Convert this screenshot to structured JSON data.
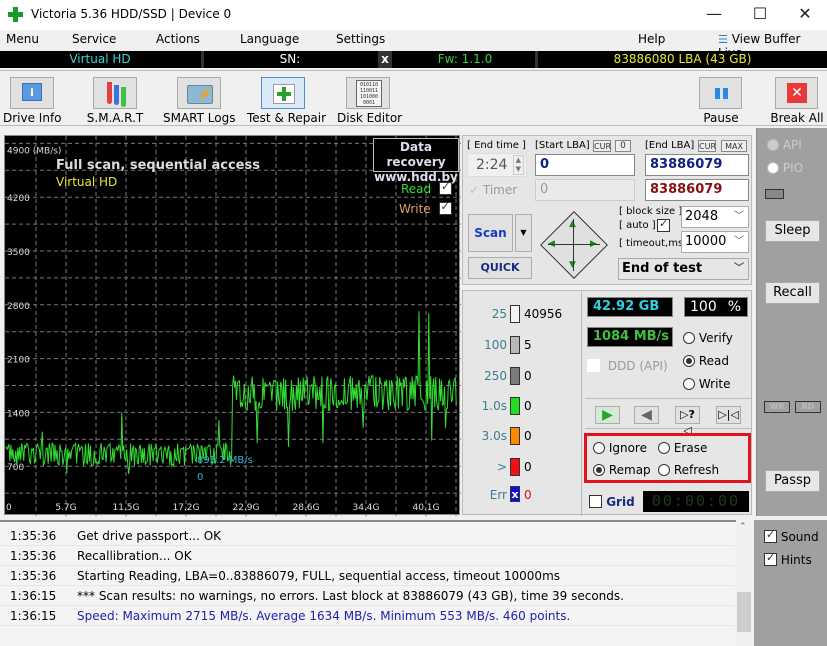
{
  "window": {
    "title": "Victoria 5.36 HDD/SSD | Device 0",
    "controls": {
      "minimize": "—",
      "maximize": "☐",
      "close": "✕"
    }
  },
  "menu": {
    "items": [
      "Menu",
      "Service",
      "Actions",
      "Language",
      "Settings"
    ],
    "help": "Help",
    "view_buffer": "View Buffer Live"
  },
  "drive_strip": {
    "model": "Virtual HD",
    "sn_label": "SN:",
    "close_glyph": "x",
    "firmware": "Fw: 1.1.0",
    "capacity": "83886080 LBA (43 GB)"
  },
  "toolbar": {
    "buttons": [
      {
        "label": "Drive Info",
        "icon": "info-icon"
      },
      {
        "label": "S.M.A.R.T",
        "icon": "test-tubes-icon"
      },
      {
        "label": "SMART Logs",
        "icon": "folder-pen-icon"
      },
      {
        "label": "Test & Repair",
        "icon": "first-aid-kit-icon",
        "active": true
      },
      {
        "label": "Disk Editor",
        "icon": "binary-document-icon"
      }
    ],
    "pause_label": "Pause",
    "break_label": "Break All",
    "binary_text": "010110\n110011\n101000\n0001"
  },
  "chart_data": {
    "type": "line",
    "title": "Full scan, sequential access",
    "subtitle": "Virtual HD",
    "ylabel": "(MB/s)",
    "y_ticks": [
      "4900 (MB/s)",
      "4200",
      "3500",
      "2800",
      "2100",
      "1400",
      "700"
    ],
    "x_ticks": [
      "0",
      "5.7G",
      "11.5G",
      "17.2G",
      "22.9G",
      "28.6G",
      "34.4G",
      "40.1G"
    ],
    "ylim": [
      0,
      4900
    ],
    "xlim_gb": [
      0,
      43
    ],
    "grid": true,
    "watermark": [
      "Data recovery",
      "www.hdd.by"
    ],
    "legend": [
      {
        "name": "Read",
        "checked": true,
        "color": "#33dd33"
      },
      {
        "name": "Write",
        "checked": true,
        "color": "#d8a070"
      }
    ],
    "cursor_readout": "895.2 MB/s",
    "cursor_value": "0",
    "series": [
      {
        "name": "Read",
        "color": "#33dd33",
        "segments": [
          {
            "from_gb": 0,
            "to_gb": 21.6,
            "base_mbps": 850,
            "spread_mbps": 150
          },
          {
            "from_gb": 21.6,
            "to_gb": 43,
            "base_mbps": 1650,
            "spread_mbps": 230
          }
        ],
        "peaks": [
          {
            "gb": 3.5,
            "mbps": 1150
          },
          {
            "gb": 11.1,
            "mbps": 1400
          },
          {
            "gb": 20.3,
            "mbps": 1300
          },
          {
            "gb": 39.4,
            "mbps": 2715
          },
          {
            "gb": 40.4,
            "mbps": 2690
          }
        ],
        "dips": [
          {
            "gb": 5.8,
            "mbps": 610
          },
          {
            "gb": 11.7,
            "mbps": 600
          },
          {
            "gb": 24.0,
            "mbps": 1000
          },
          {
            "gb": 27.0,
            "mbps": 950
          },
          {
            "gb": 30.3,
            "mbps": 1000
          },
          {
            "gb": 34.1,
            "mbps": 1200
          },
          {
            "gb": 40.7,
            "mbps": 1030
          },
          {
            "gb": 42.0,
            "mbps": 1200
          }
        ],
        "points": 460,
        "max_mbps": 2715,
        "avg_mbps": 1634,
        "min_mbps": 553
      }
    ]
  },
  "scan_params": {
    "end_time_label": "[ End time ]",
    "end_time_value": "2:24",
    "start_lba_label": "[Start LBA]",
    "cur_label": "CUR",
    "start_cur_value": "0",
    "end_lba_label": "[End LBA]",
    "max_label": "MAX",
    "start_lba": "0",
    "end_lba": "83886079",
    "timer_label": "Timer",
    "timer_checked": true,
    "start_lba_current": "0",
    "end_lba_current": "83886079",
    "block_size_label": "[ block size ]",
    "auto_label": "[ auto ]",
    "auto_checked": true,
    "timeout_label": "[ timeout,ms ]",
    "block_size": "2048",
    "timeout": "10000",
    "scan_label": "Scan",
    "quick_label": "QUICK",
    "end_action": "End of test"
  },
  "latency": [
    {
      "label": "25",
      "count": "40956",
      "color": "#f4f4f4"
    },
    {
      "label": "100",
      "count": "5",
      "color": "#b8b8b8"
    },
    {
      "label": "250",
      "count": "0",
      "color": "#7a7a7a"
    },
    {
      "label": "1.0s",
      "count": "0",
      "color": "#22dd22"
    },
    {
      "label": "3.0s",
      "count": "0",
      "color": "#ff8800"
    },
    {
      "label": ">",
      "count": "0",
      "color": "#ee1111"
    },
    {
      "label": "Err",
      "count": "0",
      "color": "#1010dd"
    }
  ],
  "status": {
    "processed": "42.92 GB",
    "percent": "100",
    "percent_sign": "%",
    "speed": "1084 MB/s",
    "ddd_label": "DDD (API)",
    "mode_options": [
      "Verify",
      "Read",
      "Write"
    ],
    "mode_selected": "Read",
    "action_options": [
      "Ignore",
      "Erase",
      "Remap",
      "Refresh"
    ],
    "action_selected": "Remap",
    "grid_label": "Grid",
    "grid_checked": false,
    "timer_display": "00:00:00",
    "highlight_color": "#e0141e"
  },
  "rail": {
    "api_label": "API",
    "pio_label": "PIO",
    "sleep_label": "Sleep",
    "recall_label": "Recall",
    "wr_label": "WR",
    "rd_label": "RD",
    "passp_label": "Passp",
    "sound_label": "Sound",
    "sound_checked": true,
    "hints_label": "Hints",
    "hints_checked": true
  },
  "log": [
    {
      "time": "1:35:36",
      "msg": "Get drive passport... OK",
      "color": "#000000"
    },
    {
      "time": "1:35:36",
      "msg": "Recallibration... OK",
      "color": "#000000"
    },
    {
      "time": "1:35:36",
      "msg": "Starting Reading, LBA=0..83886079, FULL, sequential access, timeout 10000ms",
      "color": "#000000"
    },
    {
      "time": "1:36:15",
      "msg": "*** Scan results: no warnings, no errors. Last block at 83886079 (43 GB), time 39 seconds.",
      "color": "#000000"
    },
    {
      "time": "1:36:15",
      "msg": "Speed: Maximum 2715 MB/s. Average 1634 MB/s. Minimum 553 MB/s. 460 points.",
      "color": "#2020b0"
    }
  ]
}
